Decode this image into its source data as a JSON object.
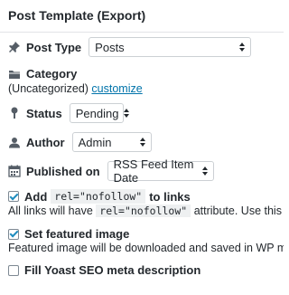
{
  "header": {
    "title": "Post Template (Export)"
  },
  "post_type": {
    "label": "Post Type",
    "value": "Posts",
    "icon": "pin-icon"
  },
  "category": {
    "label": "Category",
    "value": "(Uncategorized)",
    "link": "customize",
    "icon": "folder-icon"
  },
  "status": {
    "label": "Status",
    "value": "Pending",
    "icon": "map-pin-icon"
  },
  "author": {
    "label": "Author",
    "value": "Admin",
    "icon": "user-icon"
  },
  "published_on": {
    "label": "Published on",
    "value": "RSS Feed Item Date",
    "icon": "calendar-icon"
  },
  "nofollow": {
    "label_pre": "Add",
    "code": "rel=\"nofollow\"",
    "label_post": "to links",
    "checked": true,
    "desc_pre": "All links will have",
    "desc_code": "rel=\"nofollow\"",
    "desc_post": "attribute. Use this option only"
  },
  "featured_image": {
    "label": "Set featured image",
    "checked": true,
    "desc": "Featured image will be downloaded and saved in WP media library"
  },
  "yoast": {
    "label": "Fill Yoast SEO meta description",
    "checked": false
  }
}
